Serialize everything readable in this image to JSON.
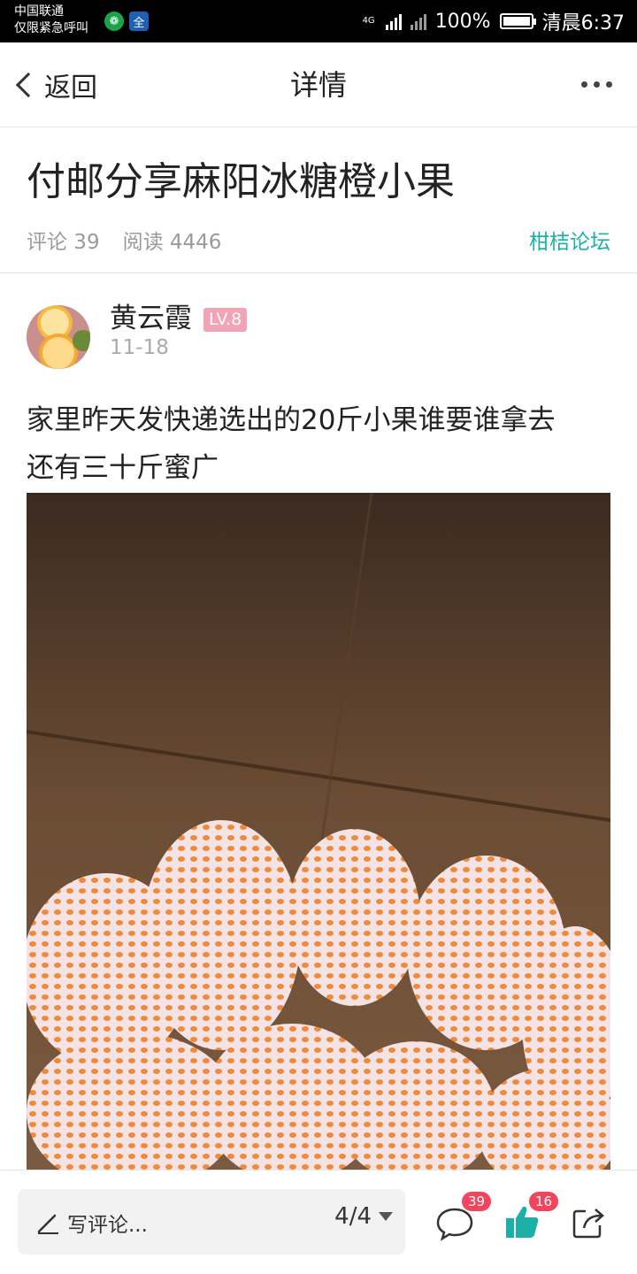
{
  "status_bar": {
    "carrier_line1": "中国联通",
    "carrier_line2": "仅限紧急呼叫",
    "network": "4G",
    "battery": "100%",
    "time": "清晨6:37",
    "app_badges": [
      "wechat-like-icon",
      "quan-icon"
    ],
    "app_badge_text": [
      "❁",
      "全"
    ]
  },
  "nav": {
    "back_label": "返回",
    "title": "详情"
  },
  "post": {
    "title": "付邮分享麻阳冰糖橙小果",
    "comments_label": "评论 39",
    "reads_label": "阅读 4446",
    "forum": "柑桔论坛",
    "author": {
      "name": "黄云霞",
      "level": "LV.8",
      "date": "11-18"
    },
    "body_line1": "家里昨天发快递选出的20斤小果谁要谁拿去",
    "body_line2": "还有三十斤蜜广"
  },
  "bottom": {
    "comment_placeholder": "写评论...",
    "page_indicator": "4/4",
    "comment_count": "39",
    "like_count": "16"
  },
  "colors": {
    "accent": "#1cb0a8",
    "badge_red": "#f0455c",
    "level_pink": "#f2a3b5"
  }
}
